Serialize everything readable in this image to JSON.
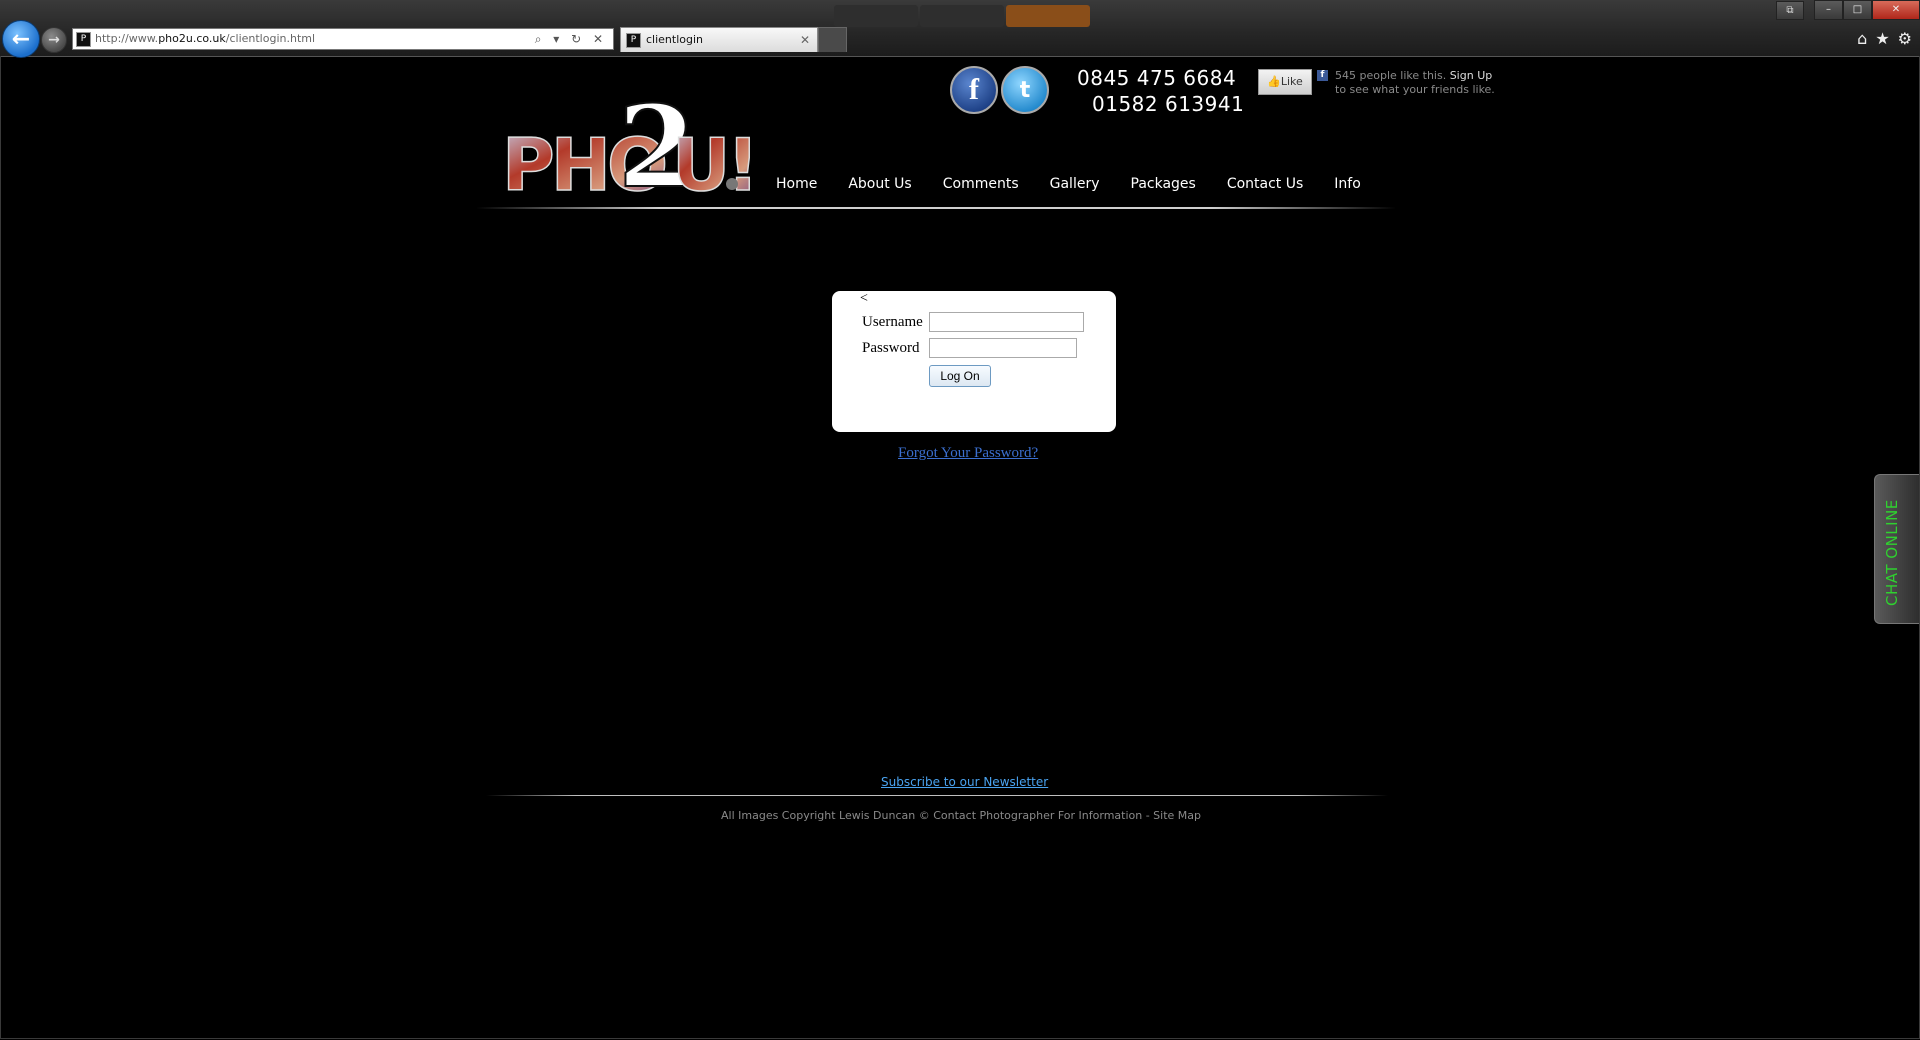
{
  "browser": {
    "address_prefix": "http://www.",
    "address_domain": "pho2u.co.uk",
    "address_path": "/clientlogin.html",
    "tab_title": "clientlogin",
    "address_controls": "⌕ ▾ ↻ ✕",
    "tab_close": "✕",
    "window_controls": {
      "restore_extra": "⧉",
      "minimize": "–",
      "maximize": "□",
      "close": "✕"
    },
    "tool_icons": {
      "home": "⌂",
      "favorites": "★",
      "tools": "⚙"
    }
  },
  "header": {
    "phone_1": "0845 475 6684",
    "phone_2": "01582 613941",
    "facebook_glyph": "f",
    "twitter_glyph": "t",
    "like_button": "Like",
    "like_count_text": "545 people like this.",
    "signup_link": "Sign Up",
    "like_subtext": "to see what your friends like."
  },
  "nav": {
    "items": [
      "Home",
      "About Us",
      "Comments",
      "Gallery",
      "Packages",
      "Contact Us",
      "Info"
    ]
  },
  "login": {
    "stray_char": "<",
    "username_label": "Username",
    "password_label": "Password",
    "username_value": "",
    "password_value": "",
    "submit_label": "Log On",
    "forgot_link": "Forgot Your Password?"
  },
  "chat": {
    "label": "CHAT ONLINE"
  },
  "footer": {
    "newsletter_link": "Subscribe to our Newsletter",
    "copyright": "All Images Copyright Lewis Duncan © Contact Photographer For Information - Site Map"
  },
  "colors": {
    "page_bg": "#000000",
    "link_blue": "#3b6fcf",
    "newsletter_blue": "#4aa3f0",
    "chat_green": "#2fd12f",
    "back_button_blue": "#1c6fcc"
  },
  "icons": [
    "back-arrow-icon",
    "forward-arrow-icon",
    "search-icon",
    "refresh-icon",
    "stop-icon",
    "home-icon",
    "star-icon",
    "gear-icon",
    "facebook-icon",
    "twitter-icon",
    "thumbs-up-icon"
  ]
}
